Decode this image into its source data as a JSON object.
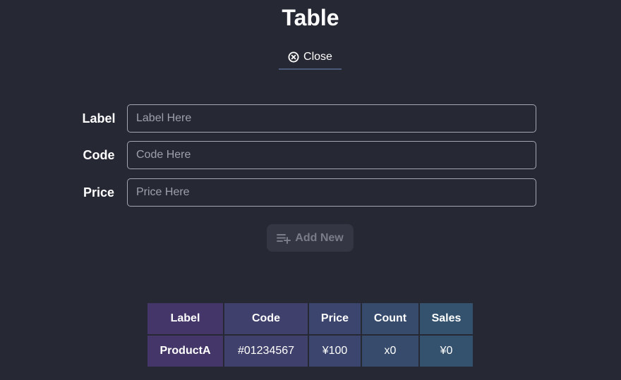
{
  "header": {
    "title": "Table",
    "close_label": "Close"
  },
  "form": {
    "fields": [
      {
        "label": "Label",
        "placeholder": "Label Here",
        "value": ""
      },
      {
        "label": "Code",
        "placeholder": "Code Here",
        "value": ""
      },
      {
        "label": "Price",
        "placeholder": "Price Here",
        "value": ""
      }
    ],
    "add_button_label": "Add New"
  },
  "table": {
    "columns": [
      "Label",
      "Code",
      "Price",
      "Count",
      "Sales"
    ],
    "rows": [
      [
        "ProductA",
        "#01234567",
        "¥100",
        "x0",
        "¥0"
      ]
    ]
  },
  "icons": {
    "close": "close-circle-icon",
    "add": "playlist-add-icon"
  },
  "colors": {
    "background": "#262834",
    "input_border": "#a4a7b3",
    "button_bg": "#343743",
    "button_text": "#7a7d88",
    "tab_underline": "#4a5a78"
  }
}
